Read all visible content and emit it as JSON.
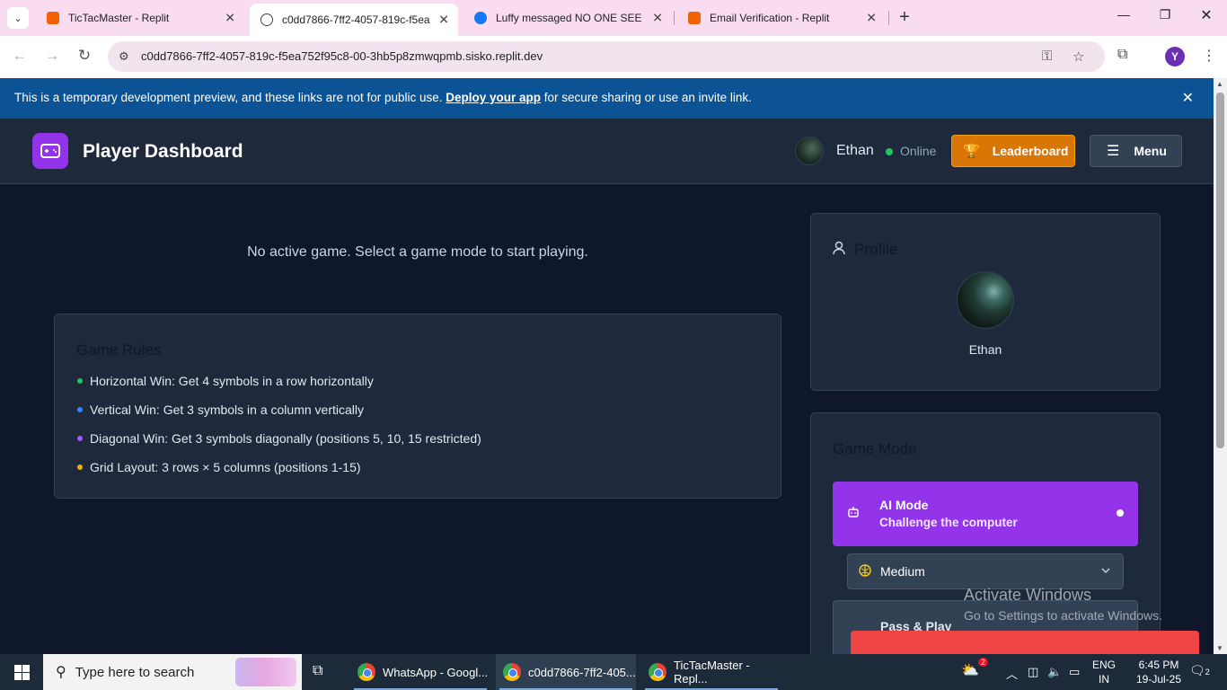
{
  "browser": {
    "tabs": [
      {
        "title": "TicTacMaster - Replit",
        "active": false
      },
      {
        "title": "c0dd7866-7ff2-4057-819c-f5ea",
        "active": true
      },
      {
        "title": "Luffy messaged NO ONE SEE",
        "active": false
      },
      {
        "title": "Email Verification - Replit",
        "active": false
      }
    ],
    "url": "c0dd7866-7ff2-4057-819c-f5ea752f95c8-00-3hb5p8zmwqpmb.sisko.replit.dev",
    "profile_initial": "Y"
  },
  "banner": {
    "text_before": "This is a temporary development preview, and these links are not for public use.",
    "link": "Deploy your app",
    "text_after": "for secure sharing or use an invite link."
  },
  "header": {
    "title": "Player Dashboard",
    "username": "Ethan",
    "status": "Online",
    "leaderboard_label": "Leaderboard",
    "menu_label": "Menu"
  },
  "main": {
    "no_game_text": "No active game. Select a game mode to start playing.",
    "rules_title": "Game Rules",
    "rules": [
      {
        "text": "Horizontal Win: Get 4 symbols in a row horizontally",
        "color": "#22c55e"
      },
      {
        "text": "Vertical Win: Get 3 symbols in a column vertically",
        "color": "#3b82f6"
      },
      {
        "text": "Diagonal Win: Get 3 symbols diagonally (positions 5, 10, 15 restricted)",
        "color": "#a855f7"
      },
      {
        "text": "Grid Layout: 3 rows × 5 columns (positions 1-15)",
        "color": "#eab308"
      }
    ]
  },
  "profile": {
    "title": "Profile",
    "name": "Ethan"
  },
  "game_mode": {
    "title": "Game Mode",
    "ai_title": "AI Mode",
    "ai_subtitle": "Challenge the computer",
    "difficulty": "Medium",
    "pass_title": "Pass & Play"
  },
  "watermark": {
    "line1": "Activate Windows",
    "line2": "Go to Settings to activate Windows."
  },
  "taskbar": {
    "search_placeholder": "Type here to search",
    "apps": [
      {
        "label": "WhatsApp - Googl..."
      },
      {
        "label": "c0dd7866-7ff2-405..."
      },
      {
        "label": "TicTacMaster - Repl..."
      }
    ],
    "weather_badge": "2",
    "lang1": "ENG",
    "lang2": "IN",
    "time": "6:45 PM",
    "date": "19-Jul-25",
    "notifications": "2"
  }
}
